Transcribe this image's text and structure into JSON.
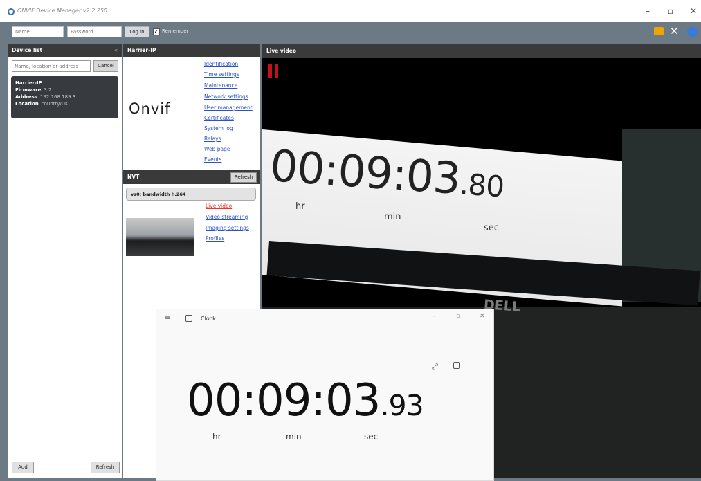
{
  "window": {
    "title": "ONVIF Device Manager v2.2.250"
  },
  "toolbar": {
    "name_placeholder": "Name",
    "password_placeholder": "Password",
    "login_label": "Log in",
    "remember_label": "Remember",
    "remember_checked": true
  },
  "device_list": {
    "title": "Device list",
    "search_placeholder": "Name, location or address",
    "cancel_label": "Cancel",
    "device": {
      "name": "Harrier-IP",
      "firmware_label": "Firmware",
      "firmware_value": "3.2",
      "address_label": "Address",
      "address_value": "192.168.189.3",
      "location_label": "Location",
      "location_value": "country/UK"
    },
    "add_label": "Add",
    "refresh_label": "Refresh"
  },
  "details": {
    "title": "Harrier-IP",
    "logo_text": "Onvif",
    "links": [
      "Identification",
      "Time settings",
      "Maintenance",
      "Network settings",
      "User management",
      "Certificates",
      "System log",
      "Relays",
      "Web page",
      "Events"
    ],
    "nvt_title": "NVT",
    "nvt_refresh_label": "Refresh",
    "stream_name": "vs0: bandwidth h.264",
    "stream_links": [
      "Live video",
      "Video streaming",
      "Imaging settings",
      "Profiles"
    ]
  },
  "live": {
    "title": "Live video",
    "time_main": "00:09:03",
    "time_frac": ".80",
    "units": [
      "hr",
      "min",
      "sec"
    ],
    "brand": "DELL"
  },
  "clock": {
    "title": "Clock",
    "time_main": "00:09:03",
    "time_frac": ".93",
    "units": [
      "hr",
      "min",
      "sec"
    ]
  },
  "colors": {
    "toolbar_bg": "#6c7a86",
    "panel_header_bg": "#3a3a3a",
    "link": "#2b52c8",
    "active_link": "#e8372c",
    "pause_red": "#c1111a"
  }
}
